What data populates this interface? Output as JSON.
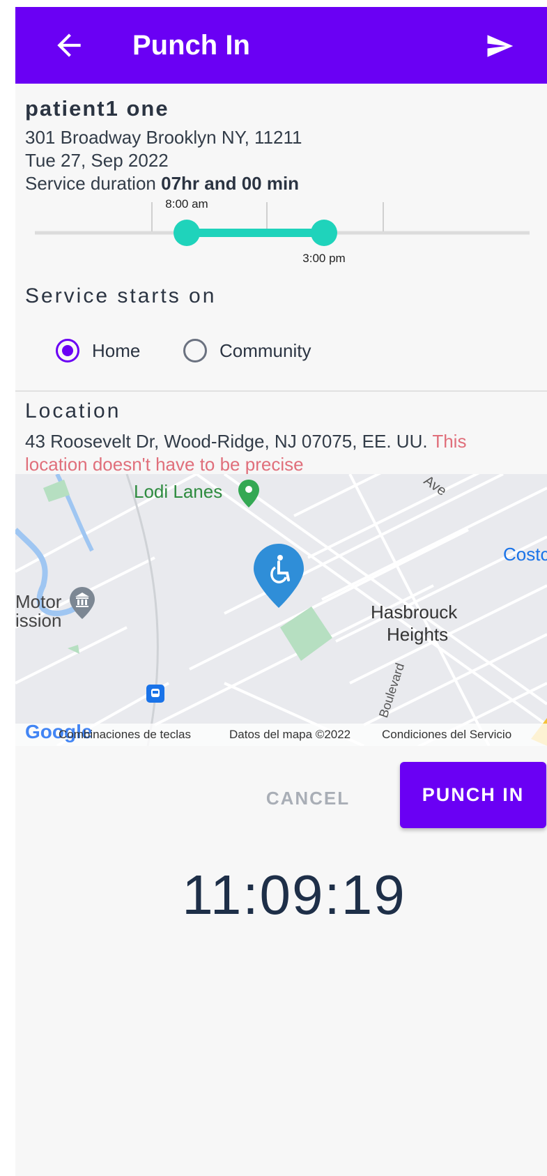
{
  "appbar": {
    "title": "Punch In",
    "back_icon": "arrow-left-icon",
    "send_icon": "send-icon",
    "color": "#6a00f4"
  },
  "patient": {
    "name": "patient1 one",
    "address": "301 Broadway Brooklyn NY, 11211",
    "date": "Tue 27, Sep 2022",
    "duration_prefix": "Service duration ",
    "duration_value": "07hr and 00 min"
  },
  "time_range": {
    "start_label": "8:00 am",
    "end_label": "3:00 pm"
  },
  "service_location": {
    "heading": "Service starts on",
    "options": [
      {
        "label": "Home",
        "selected": true
      },
      {
        "label": "Community",
        "selected": false
      }
    ]
  },
  "location": {
    "heading": "Location",
    "address": "43 Roosevelt Dr, Wood-Ridge, NJ 07075, EE. UU. ",
    "note_part1": "This",
    "note_part2": "location doesn't have to be precise"
  },
  "map": {
    "labels": {
      "lodi": "Lodi Lanes",
      "ave": "Ave",
      "costco": "Costc",
      "motor1": "Motor",
      "motor2": "ission",
      "hasbrouck1": "Hasbrouck",
      "hasbrouck2": "Heights",
      "boulevard": "Boulevard"
    },
    "attribution": {
      "google": "Google",
      "shortcuts": "Combinaciones de teclas",
      "mapdata": "Datos del mapa ©2022",
      "terms": "Condiciones del Servicio"
    },
    "pin_icon": "wheelchair-pin-icon"
  },
  "actions": {
    "cancel": "CANCEL",
    "punch_in": "PUNCH IN"
  },
  "clock": "11:09:19"
}
